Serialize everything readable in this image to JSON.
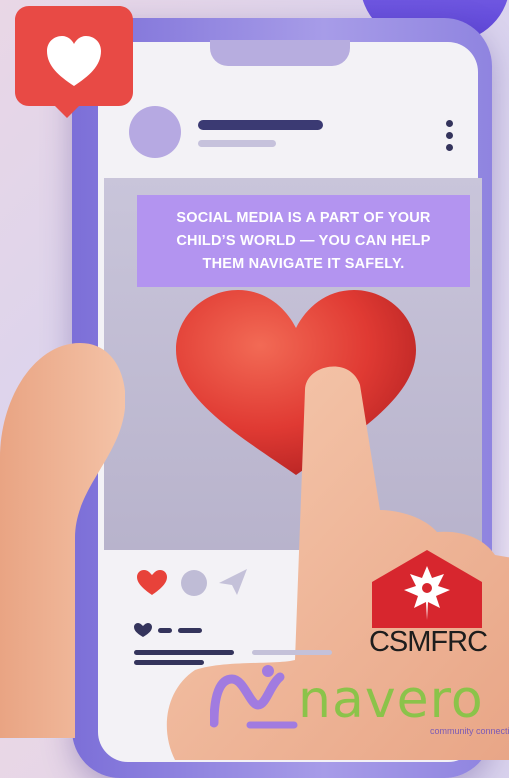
{
  "post": {
    "caption": "SOCIAL MEDIA IS A PART OF YOUR\nCHILD’S WORLD — YOU CAN HELP\nTHEM NAVIGATE IT SAFELY."
  },
  "logos": {
    "csmfrc_text": "CSMFRC",
    "navero_text": "navero",
    "navero_tagline": "community connection"
  },
  "icons": [
    "heart-icon",
    "comment-icon",
    "send-icon",
    "more-options-icon",
    "notification-heart-icon"
  ],
  "colors": {
    "accent_purple": "#b394f0",
    "heart_red": "#e8423a",
    "phone_frame": "#8f84e0",
    "csmfrc_red": "#d7262e",
    "navero_green": "#8bc34a"
  }
}
